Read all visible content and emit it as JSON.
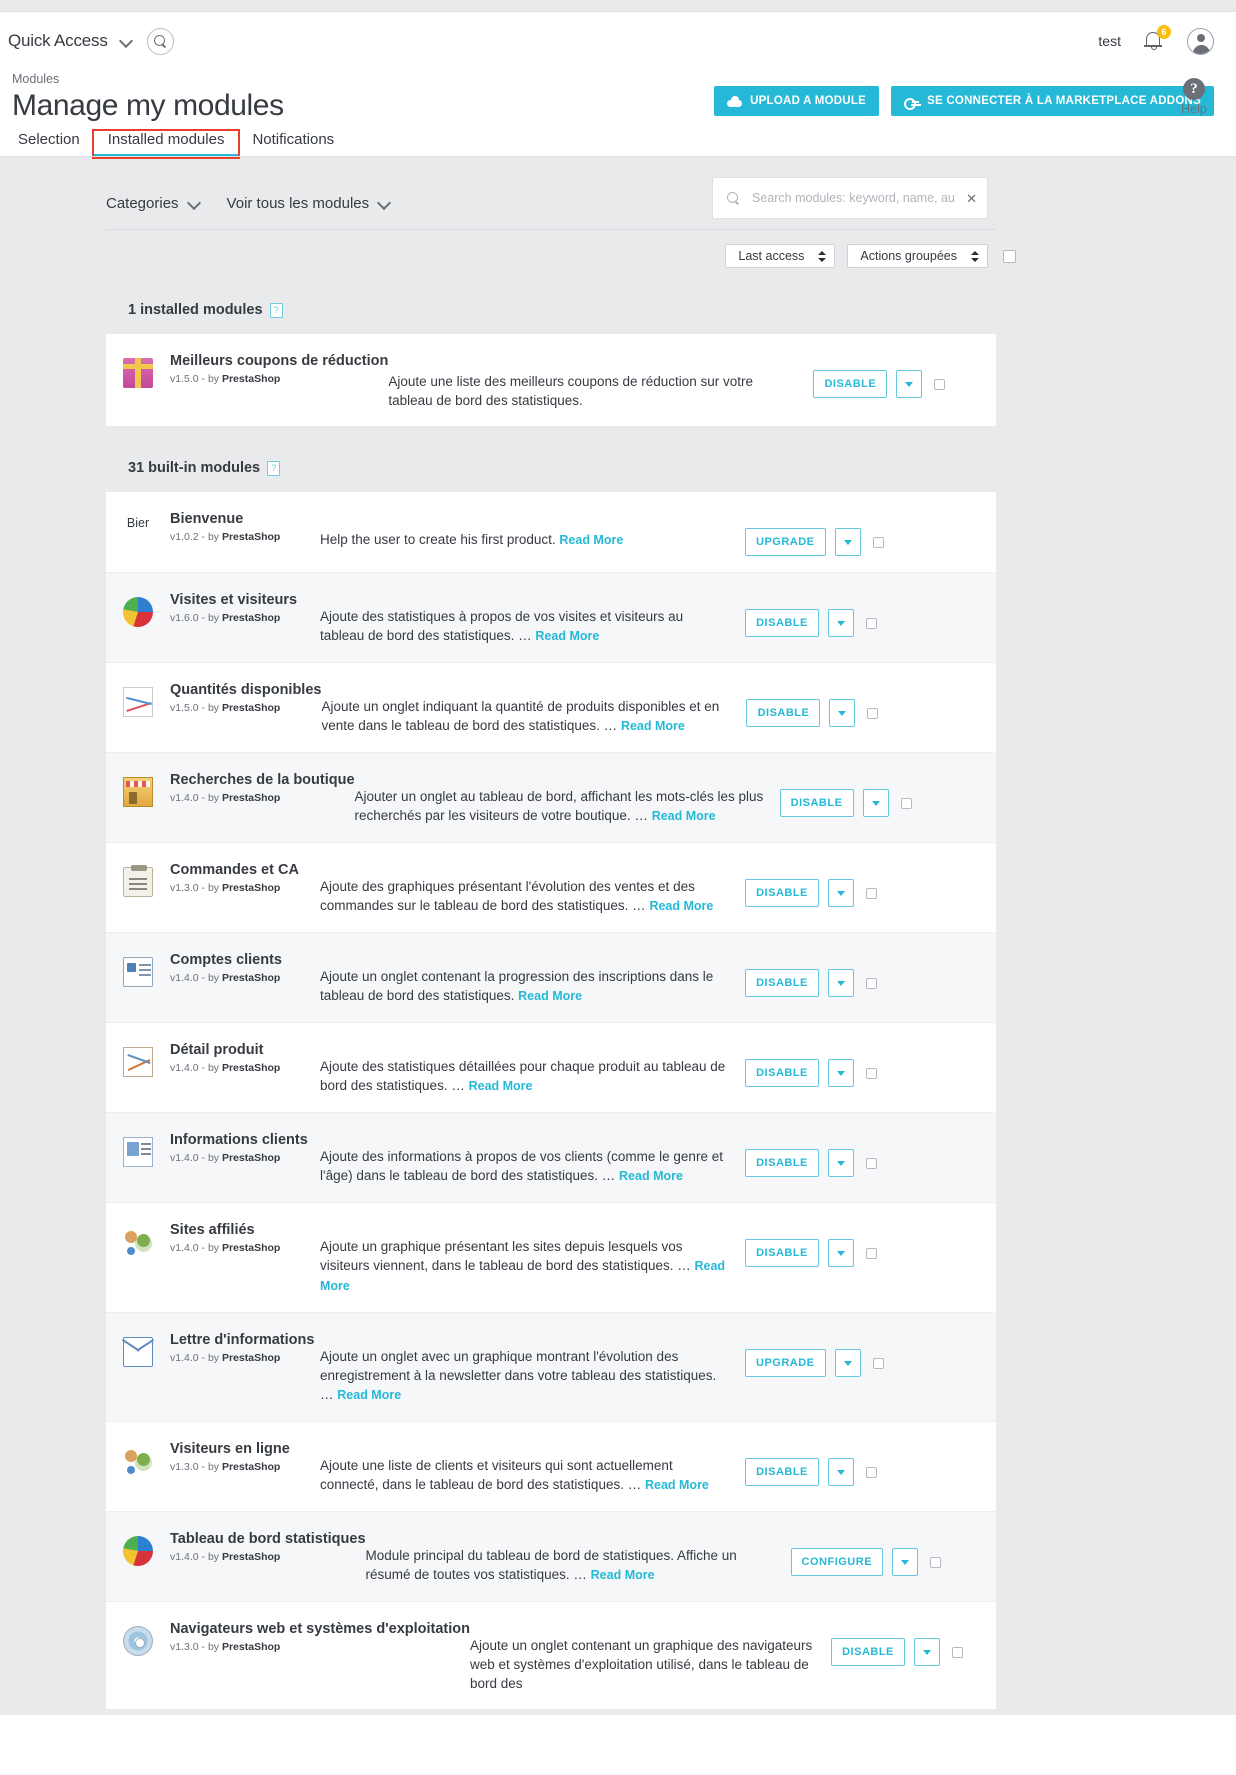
{
  "header": {
    "quick_access": "Quick Access",
    "search_icon": "search-icon",
    "user_name": "test",
    "notification_count": "6",
    "breadcrumb": "Modules",
    "page_title": "Manage my modules",
    "upload_button": "UPLOAD A MODULE",
    "marketplace_button": "SE CONNECTER À LA MARKETPLACE ADDONS",
    "help_symbol": "?",
    "help_label": "Help"
  },
  "tabs": [
    {
      "label": "Selection",
      "active": false
    },
    {
      "label": "Installed modules",
      "active": true
    },
    {
      "label": "Notifications",
      "active": false
    }
  ],
  "filters": {
    "categories": "Categories",
    "view_all": "Voir tous les modules",
    "search_placeholder": "Search modules: keyword, name, author",
    "clear_symbol": "✕"
  },
  "sort": {
    "order_by": "Last access",
    "bulk_actions": "Actions groupées"
  },
  "sections": [
    {
      "title": "1 installed modules",
      "tip": "?"
    },
    {
      "title": "31 built-in modules",
      "tip": "?"
    }
  ],
  "installed_modules": [
    {
      "icon": "gift-icon",
      "name": "Meilleurs coupons de réduction",
      "version": "v1.5.0",
      "by": "by",
      "author": "PrestaShop",
      "description": "Ajoute une liste des meilleurs coupons de réduction sur votre tableau de bord des statistiques.",
      "read_more": "",
      "action": "DISABLE"
    }
  ],
  "builtin_modules": [
    {
      "icon": "text-bier",
      "icon_text": "Bier",
      "name": "Bienvenue",
      "version": "v1.0.2",
      "by": "by",
      "author": "PrestaShop",
      "description": "Help the user to create his first product.",
      "read_more": "Read More",
      "action": "UPGRADE"
    },
    {
      "icon": "pie-chart-icon",
      "name": "Visites et visiteurs",
      "version": "v1.6.0",
      "by": "by",
      "author": "PrestaShop",
      "description": "Ajoute des statistiques à propos de vos visites et visiteurs au tableau de bord des statistiques. …",
      "read_more": "Read More",
      "action": "DISABLE"
    },
    {
      "icon": "line-chart-icon",
      "name": "Quantités disponibles",
      "version": "v1.5.0",
      "by": "by",
      "author": "PrestaShop",
      "description": "Ajoute un onglet indiquant la quantité de produits disponibles et en vente dans le tableau de bord des statistiques. …",
      "read_more": "Read More",
      "action": "DISABLE"
    },
    {
      "icon": "shop-icon",
      "name": "Recherches de la boutique",
      "version": "v1.4.0",
      "by": "by",
      "author": "PrestaShop",
      "description": "Ajouter un onglet au tableau de bord, affichant les mots-clés les plus recherchés par les visiteurs de votre boutique. …",
      "read_more": "Read More",
      "action": "DISABLE"
    },
    {
      "icon": "clipboard-icon",
      "name": "Commandes et CA",
      "version": "v1.3.0",
      "by": "by",
      "author": "PrestaShop",
      "description": "Ajoute des graphiques présentant l'évolution des ventes et des commandes sur le tableau de bord des statistiques. …",
      "read_more": "Read More",
      "action": "DISABLE"
    },
    {
      "icon": "id-card-icon",
      "name": "Comptes clients",
      "version": "v1.4.0",
      "by": "by",
      "author": "PrestaShop",
      "description": "Ajoute un onglet contenant la progression des inscriptions dans le tableau de bord des statistiques.",
      "read_more": "Read More",
      "action": "DISABLE"
    },
    {
      "icon": "product-chart-icon",
      "name": "Détail produit",
      "version": "v1.4.0",
      "by": "by",
      "author": "PrestaShop",
      "description": "Ajoute des statistiques détaillées pour chaque produit au tableau de bord des statistiques. …",
      "read_more": "Read More",
      "action": "DISABLE"
    },
    {
      "icon": "customer-info-icon",
      "name": "Informations clients",
      "version": "v1.4.0",
      "by": "by",
      "author": "PrestaShop",
      "description": "Ajoute des informations à propos de vos clients (comme le genre et l'âge) dans le tableau de bord des statistiques. …",
      "read_more": "Read More",
      "action": "DISABLE"
    },
    {
      "icon": "users-icon",
      "name": "Sites affiliés",
      "version": "v1.4.0",
      "by": "by",
      "author": "PrestaShop",
      "description": "Ajoute un graphique présentant les sites depuis lesquels vos visiteurs viennent, dans le tableau de bord des statistiques. …",
      "read_more": "Read More",
      "action": "DISABLE"
    },
    {
      "icon": "envelope-icon",
      "name": "Lettre d'informations",
      "version": "v1.4.0",
      "by": "by",
      "author": "PrestaShop",
      "description": "Ajoute un onglet avec un graphique montrant l'évolution des enregistrement à la newsletter dans votre tableau des statistiques. …",
      "read_more": "Read More",
      "action": "UPGRADE"
    },
    {
      "icon": "users-icon",
      "name": "Visiteurs en ligne",
      "version": "v1.3.0",
      "by": "by",
      "author": "PrestaShop",
      "description": "Ajoute une liste de clients et visiteurs qui sont actuellement connecté, dans le tableau de bord des statistiques. …",
      "read_more": "Read More",
      "action": "DISABLE"
    },
    {
      "icon": "pie-chart-icon",
      "name": "Tableau de bord statistiques",
      "version": "v1.4.0",
      "by": "by",
      "author": "PrestaShop",
      "description": "Module principal du tableau de bord de statistiques. Affiche un résumé de toutes vos statistiques. …",
      "read_more": "Read More",
      "action": "CONFIGURE"
    },
    {
      "icon": "cd-icon",
      "name": "Navigateurs web et systèmes d'exploitation",
      "version": "v1.3.0",
      "by": "by",
      "author": "PrestaShop",
      "description": "Ajoute un onglet contenant un graphique des navigateurs web et systèmes d'exploitation utilisé, dans le tableau de bord des",
      "read_more": "",
      "action": "DISABLE"
    }
  ],
  "colors": {
    "accent": "#25b9d7",
    "badge": "#fbbd09",
    "highlight": "#e8402a",
    "page_bg": "#e9eaec"
  }
}
